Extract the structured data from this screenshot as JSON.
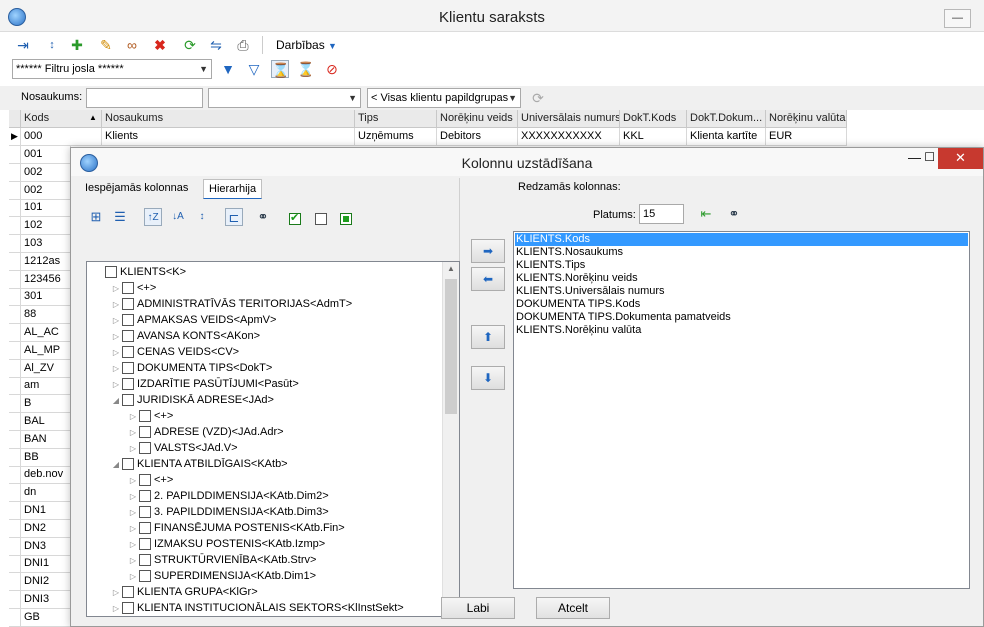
{
  "main": {
    "title": "Klientu saraksts",
    "actions_label": "Darbības",
    "filter_combo": "****** Filtru josla ******",
    "search_label": "Nosaukums:",
    "group_combo": "< Visas klientu papildgrupas >",
    "columns": [
      "Kods",
      "Nosaukums",
      "Tips",
      "Norēķinu veids",
      "Universālais numurs",
      "DokT.Kods",
      "DokT.Dokum...",
      "Norēķinu valūta"
    ],
    "first_row": [
      "000",
      "Klients",
      "Uzņēmums",
      "Debitors",
      "XXXXXXXXXXX",
      "KKL",
      "Klienta kartīte",
      "EUR"
    ],
    "codes": [
      "001",
      "002",
      "002",
      "101",
      "102",
      "103",
      "1212as",
      "123456",
      "301",
      "88",
      "AL_AC",
      "AL_MP",
      "Al_ZV",
      "am",
      "B",
      "BAL",
      "BAN",
      "BB",
      "deb.nov",
      "dn",
      "DN1",
      "DN2",
      "DN3",
      "DNI1",
      "DNI2",
      "DNI3",
      "GB"
    ]
  },
  "dialog": {
    "title": "Kolonnu uzstādīšana",
    "tab_available": "Iespējamās kolonnas",
    "tab_hierarchy": "Hierarhija",
    "visible_label": "Redzamās kolonnas:",
    "width_label": "Platums:",
    "width_value": "15",
    "tree": [
      {
        "text": "KLIENTS<K>",
        "level": 0,
        "exp": ""
      },
      {
        "text": "<+>",
        "level": 1,
        "exp": "▷"
      },
      {
        "text": "ADMINISTRATĪVĀS TERITORIJAS<AdmT>",
        "level": 1,
        "exp": "▷"
      },
      {
        "text": "APMAKSAS VEIDS<ApmV>",
        "level": 1,
        "exp": "▷"
      },
      {
        "text": "AVANSA KONTS<AKon>",
        "level": 1,
        "exp": "▷"
      },
      {
        "text": "CENAS VEIDS<CV>",
        "level": 1,
        "exp": "▷"
      },
      {
        "text": "DOKUMENTA TIPS<DokT>",
        "level": 1,
        "exp": "▷"
      },
      {
        "text": "IZDARĪTIE PASŪTĪJUMI<Pasūt>",
        "level": 1,
        "exp": "▷"
      },
      {
        "text": "JURIDISKĀ ADRESE<JAd>",
        "level": 1,
        "exp": "◢"
      },
      {
        "text": "<+>",
        "level": 2,
        "exp": "▷"
      },
      {
        "text": "ADRESE (VZD)<JAd.Adr>",
        "level": 2,
        "exp": "▷"
      },
      {
        "text": "VALSTS<JAd.V>",
        "level": 2,
        "exp": "▷"
      },
      {
        "text": "KLIENTA ATBILDĪGAIS<KAtb>",
        "level": 1,
        "exp": "◢"
      },
      {
        "text": "<+>",
        "level": 2,
        "exp": "▷"
      },
      {
        "text": "2. PAPILDDIMENSIJA<KAtb.Dim2>",
        "level": 2,
        "exp": "▷"
      },
      {
        "text": "3. PAPILDDIMENSIJA<KAtb.Dim3>",
        "level": 2,
        "exp": "▷"
      },
      {
        "text": "FINANSĒJUMA POSTENIS<KAtb.Fin>",
        "level": 2,
        "exp": "▷"
      },
      {
        "text": "IZMAKSU POSTENIS<KAtb.Izmp>",
        "level": 2,
        "exp": "▷"
      },
      {
        "text": "STRUKTŪRVIENĪBA<KAtb.Strv>",
        "level": 2,
        "exp": "▷"
      },
      {
        "text": "SUPERDIMENSIJA<KAtb.Dim1>",
        "level": 2,
        "exp": "▷"
      },
      {
        "text": "KLIENTA GRUPA<KlGr>",
        "level": 1,
        "exp": "▷"
      },
      {
        "text": "KLIENTA INSTITUCIONĀLAIS SEKTORS<KlInstSekt>",
        "level": 1,
        "exp": "▷"
      }
    ],
    "visible_columns": [
      "KLIENTS.Kods",
      "KLIENTS.Nosaukums",
      "KLIENTS.Tips",
      "KLIENTS.Norēķinu veids",
      "KLIENTS.Universālais numurs",
      "DOKUMENTA TIPS.Kods",
      "DOKUMENTA TIPS.Dokumenta pamatveids",
      "KLIENTS.Norēķinu valūta"
    ],
    "ok_label": "Labi",
    "cancel_label": "Atcelt"
  },
  "colors": {
    "selection": "#3399ff",
    "close": "#c7392f",
    "accent": "#1f66c0"
  }
}
